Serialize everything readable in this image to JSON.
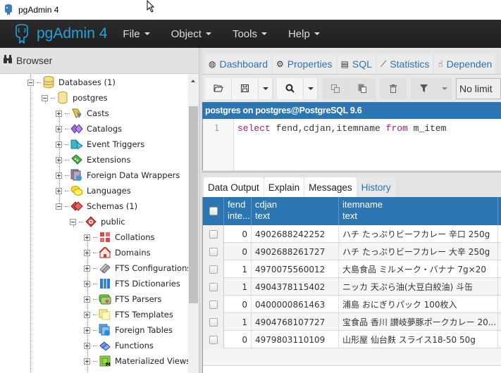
{
  "window": {
    "title": "pgAdmin 4"
  },
  "navbar": {
    "brand": "pgAdmin 4",
    "menus": [
      {
        "label": "File"
      },
      {
        "label": "Object"
      },
      {
        "label": "Tools"
      },
      {
        "label": "Help"
      }
    ]
  },
  "browser": {
    "title": "Browser",
    "tree": [
      {
        "label": "Databases (1)",
        "icon": "databases-icon",
        "state": "expanded"
      },
      {
        "label": "postgres",
        "icon": "database-icon",
        "state": "expanded"
      },
      {
        "label": "Casts",
        "icon": "casts-icon",
        "state": "collapsed"
      },
      {
        "label": "Catalogs",
        "icon": "catalogs-icon",
        "state": "collapsed"
      },
      {
        "label": "Event Triggers",
        "icon": "event-triggers-icon",
        "state": "collapsed"
      },
      {
        "label": "Extensions",
        "icon": "extensions-icon",
        "state": "collapsed"
      },
      {
        "label": "Foreign Data Wrappers",
        "icon": "foreign-data-wrappers-icon",
        "state": "collapsed"
      },
      {
        "label": "Languages",
        "icon": "languages-icon",
        "state": "collapsed"
      },
      {
        "label": "Schemas (1)",
        "icon": "schemas-icon",
        "state": "expanded"
      },
      {
        "label": "public",
        "icon": "schema-icon",
        "state": "expanded"
      },
      {
        "label": "Collations",
        "icon": "collations-icon",
        "state": "collapsed"
      },
      {
        "label": "Domains",
        "icon": "domains-icon",
        "state": "collapsed"
      },
      {
        "label": "FTS Configurations",
        "icon": "fts-configurations-icon",
        "state": "collapsed"
      },
      {
        "label": "FTS Dictionaries",
        "icon": "fts-dictionaries-icon",
        "state": "collapsed"
      },
      {
        "label": "FTS Parsers",
        "icon": "fts-parsers-icon",
        "state": "collapsed"
      },
      {
        "label": "FTS Templates",
        "icon": "fts-templates-icon",
        "state": "collapsed"
      },
      {
        "label": "Foreign Tables",
        "icon": "foreign-tables-icon",
        "state": "collapsed"
      },
      {
        "label": "Functions",
        "icon": "functions-icon",
        "state": "collapsed"
      },
      {
        "label": "Materialized Views",
        "icon": "materialized-views-icon",
        "state": "collapsed"
      }
    ]
  },
  "panel_tabs": [
    {
      "label": "Dashboard",
      "icon": "dashboard-icon"
    },
    {
      "label": "Properties",
      "icon": "properties-icon"
    },
    {
      "label": "SQL",
      "icon": "sql-icon"
    },
    {
      "label": "Statistics",
      "icon": "statistics-icon"
    },
    {
      "label": "Dependen",
      "icon": "dependencies-icon"
    }
  ],
  "toolbar": {
    "limit_value": "No limit"
  },
  "connection": {
    "label": "postgres on postgres@PostgreSQL 9.6"
  },
  "editor": {
    "line_number": "1",
    "tokens": [
      {
        "text": "select",
        "kw": true
      },
      {
        "text": " fend,cdjan,itemname ",
        "kw": false
      },
      {
        "text": "from",
        "kw": true
      },
      {
        "text": " m_item",
        "kw": false
      }
    ]
  },
  "result_tabs": [
    {
      "label": "Data Output"
    },
    {
      "label": "Explain"
    },
    {
      "label": "Messages"
    },
    {
      "label": "History"
    }
  ],
  "grid": {
    "columns": [
      {
        "name": "fend",
        "type": "inte..."
      },
      {
        "name": "cdjan",
        "type": "text"
      },
      {
        "name": "itemname",
        "type": "text"
      }
    ],
    "rows": [
      {
        "fend": "0",
        "cdjan": "4902688242252",
        "itemname": "ハチ たっぷりビーフカレー 辛口 250g"
      },
      {
        "fend": "0",
        "cdjan": "4902688261727",
        "itemname": "ハチ たっぷりビーフカレー 大辛 250g"
      },
      {
        "fend": "1",
        "cdjan": "4970075560012",
        "itemname": "大島食品 ミルメーク・バナナ 7g×20"
      },
      {
        "fend": "1",
        "cdjan": "4904378115402",
        "itemname": "ニッカ 天ぷら油(大豆白絞油) 斗缶"
      },
      {
        "fend": "0",
        "cdjan": "0400000861463",
        "itemname": "浦島 おにぎりパック 100枚入"
      },
      {
        "fend": "1",
        "cdjan": "4904768107727",
        "itemname": "宝食品 香川 讃岐夢豚ポークカレー 20..."
      },
      {
        "fend": "0",
        "cdjan": "4979803110109",
        "itemname": "山形屋 仙台麩 スライス18-50 50g"
      }
    ]
  }
}
